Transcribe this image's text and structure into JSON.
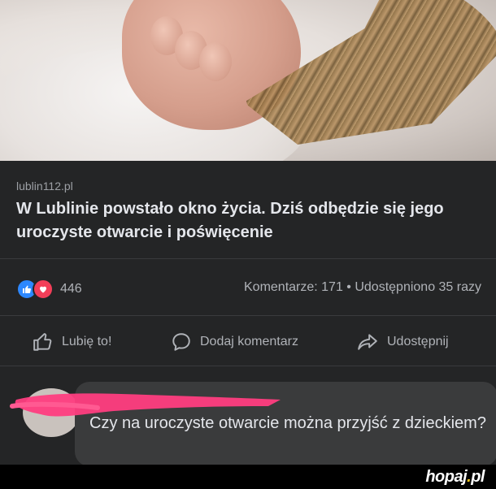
{
  "post": {
    "source": "lublin112.pl",
    "headline": "W Lublinie powstało okno życia. Dziś odbędzie się jego uroczyste otwarcie i poświęcenie",
    "reaction_count": "446",
    "stats": "Komentarze: 171 • Udostępniono 35 razy"
  },
  "actions": {
    "like": "Lubię to!",
    "comment": "Dodaj komentarz",
    "share": "Udostępnij"
  },
  "comment": {
    "text": "Czy na uroczyste otwarcie można przyjść z dzieckiem?"
  },
  "watermark": {
    "part1": "hopaj",
    "dot": ".",
    "part2": "pl"
  },
  "colors": {
    "like_blue": "#2d88ff",
    "love_red": "#f33e58",
    "scribble_pink": "#ff3d7f",
    "watermark_dot": "#f5c518"
  }
}
